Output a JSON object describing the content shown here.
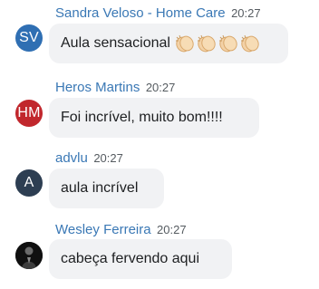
{
  "messages": [
    {
      "author": "Sandra Veloso - Home Care",
      "time": "20:27",
      "text": "Aula sensacional",
      "avatar": {
        "initials": "SV",
        "color": "#2f6fb3"
      },
      "emoji": {
        "name": "clapping-hands-icon",
        "count": 4
      }
    },
    {
      "author": "Heros Martins",
      "time": "20:27",
      "text": "Foi incrível, muito bom!!!!",
      "avatar": {
        "initials": "HM",
        "color": "#c1272d"
      }
    },
    {
      "author": "advlu",
      "time": "20:27",
      "text": "aula incrível",
      "avatar": {
        "initials": "A",
        "color": "#2d3e52"
      }
    },
    {
      "author": "Wesley Ferreira",
      "time": "20:27",
      "text": "cabeça fervendo aqui",
      "avatar": {
        "type": "photo",
        "color": "#151515"
      }
    }
  ]
}
